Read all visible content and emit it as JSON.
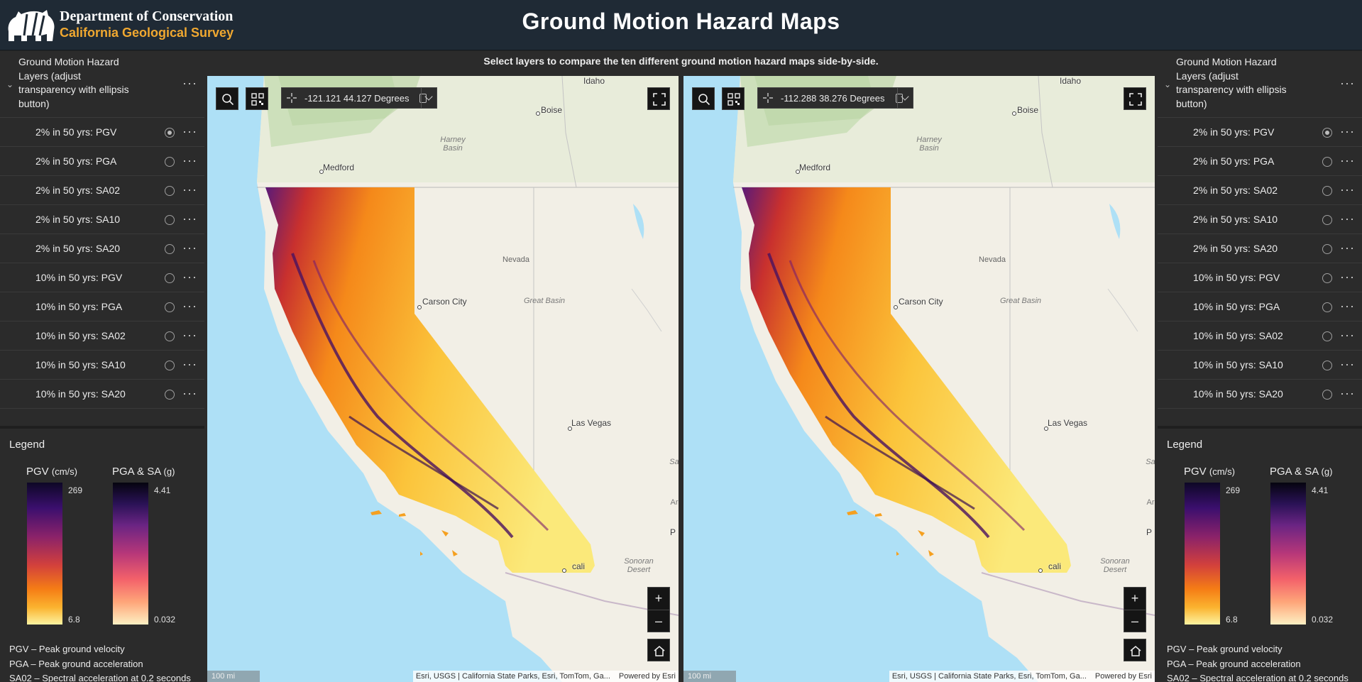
{
  "header": {
    "org_name": "Department of Conservation",
    "org_sub": "California Geological Survey",
    "title": "Ground Motion Hazard Maps"
  },
  "instruction": "Select layers to compare the ten different ground motion hazard maps side-by-side.",
  "panels": {
    "layers_title": "Ground Motion Hazard Layers (adjust transparency with ellipsis button)",
    "layers": [
      {
        "label": "2% in 50 yrs: PGV",
        "selected": true
      },
      {
        "label": "2% in 50 yrs: PGA",
        "selected": false
      },
      {
        "label": "2% in 50 yrs: SA02",
        "selected": false
      },
      {
        "label": "2% in 50 yrs: SA10",
        "selected": false
      },
      {
        "label": "2% in 50 yrs: SA20",
        "selected": false
      },
      {
        "label": "10% in 50 yrs: PGV",
        "selected": false
      },
      {
        "label": "10% in 50 yrs: PGA",
        "selected": false
      },
      {
        "label": "10% in 50 yrs: SA02",
        "selected": false
      },
      {
        "label": "10% in 50 yrs: SA10",
        "selected": false
      },
      {
        "label": "10% in 50 yrs: SA20",
        "selected": false
      }
    ],
    "more_glyph": "···",
    "chevron_glyph": "⌄"
  },
  "legend": {
    "title": "Legend",
    "pgv": {
      "name": "PGV",
      "unit": "(cm/s)",
      "max": "269",
      "min": "6.8"
    },
    "pga": {
      "name": "PGA & SA",
      "unit": "(g)",
      "max": "4.41",
      "min": "0.032"
    },
    "definitions": [
      "PGV – Peak ground velocity",
      "PGA – Peak ground acceleration",
      "SA02 – Spectral acceleration at 0.2 seconds"
    ]
  },
  "maps": {
    "left_coords": "-121.121 44.127 Degrees",
    "right_coords": "-112.288 38.276 Degrees",
    "scale": "100 mi",
    "attribution": "Esri, USGS | California State Parks, Esri, TomTom, Ga...",
    "powered": "Powered by Esri",
    "zoom_in": "+",
    "zoom_out": "–",
    "places": {
      "idaho": "Idaho",
      "boise": "Boise",
      "harney": "Harney Basin",
      "medford": "Medford",
      "nevada": "Nevada",
      "carson": "Carson City",
      "great_basin": "Great Basin",
      "las_vegas": "Las Vegas",
      "sonoran": "Sonoran Desert",
      "edge_s": "Sa",
      "edge_a": "Ar",
      "edge_p": "P",
      "mexicali": "cali"
    }
  }
}
